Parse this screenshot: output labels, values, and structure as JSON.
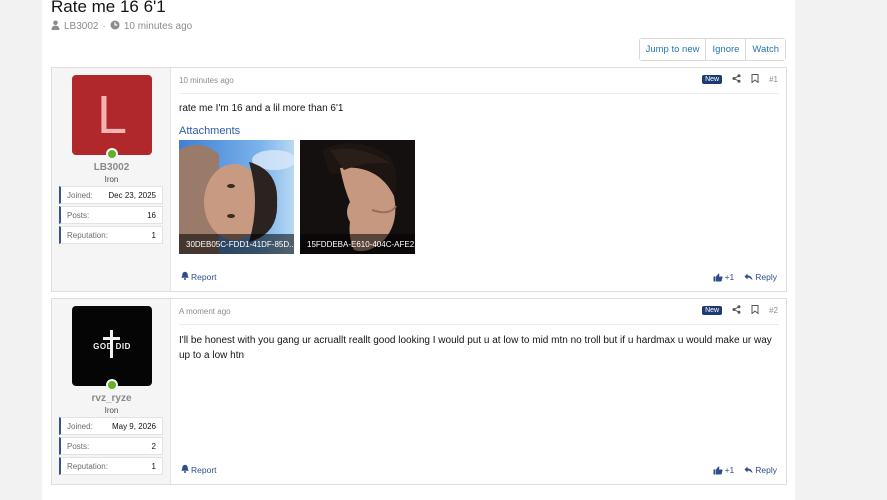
{
  "thread": {
    "title": "Rate me 16 6'1",
    "author": "LB3002",
    "separator": "·",
    "posted": "10 minutes ago"
  },
  "actions": {
    "jump": "Jump to new",
    "ignore": "Ignore",
    "watch": "Watch"
  },
  "posts": [
    {
      "avatar_letter": "L",
      "username": "LB3002",
      "user_title": "Iron",
      "stats": [
        {
          "label": "Joined:",
          "value": "Dec 23, 2025"
        },
        {
          "label": "Posts:",
          "value": "16"
        },
        {
          "label": "Reputation:",
          "value": "1"
        }
      ],
      "time": "10 minutes ago",
      "badge": "New",
      "number": "#1",
      "text": "rate me I'm 16 and a lil more than 6'1",
      "attachments_heading": "Attachments",
      "attachments": [
        {
          "caption": "30DEB05C-FDD1-41DF-85D..."
        },
        {
          "caption": "15FDDEBA-E610-404C-AFE2..."
        }
      ],
      "report": "Report",
      "likes": "+1",
      "reply": "Reply"
    },
    {
      "avatar_text": "GOD DID",
      "username": "rvz_ryze",
      "user_title": "Iron",
      "stats": [
        {
          "label": "Joined:",
          "value": "May 9, 2026"
        },
        {
          "label": "Posts:",
          "value": "2"
        },
        {
          "label": "Reputation:",
          "value": "1"
        }
      ],
      "time": "A moment ago",
      "badge": "New",
      "number": "#2",
      "text": "I'll be honest with you gang ur acruallt reallt good looking I would put u at low to mid mtn no troll but if u hardmax u would make ur way up to a low htn",
      "report": "Report",
      "likes": "+1",
      "reply": "Reply"
    }
  ],
  "colors": {
    "accent": "#2f4d8c",
    "badge": "#1e3a75",
    "online": "#63b029",
    "avatar_red": "#b0282c"
  }
}
